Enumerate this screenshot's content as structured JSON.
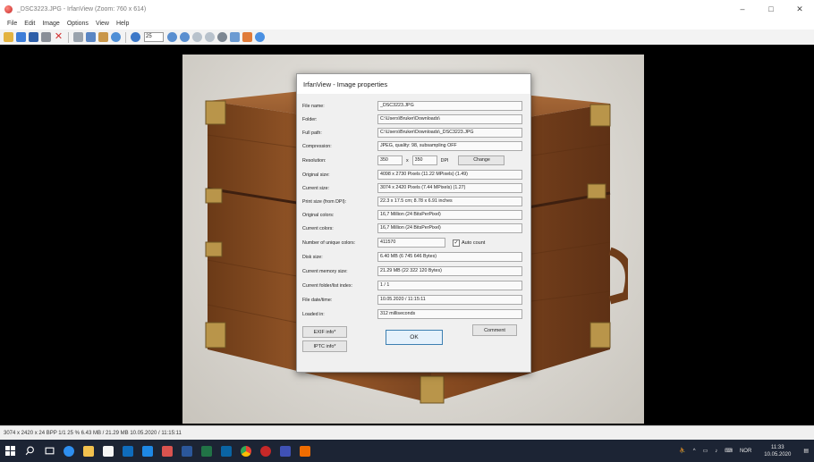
{
  "window": {
    "title": "_DSC3223.JPG - IrfanView (Zoom: 760 x 614)",
    "controls": {
      "minimize": "–",
      "maximize": "□",
      "close": "✕"
    }
  },
  "menu": [
    "File",
    "Edit",
    "Image",
    "Options",
    "View",
    "Help"
  ],
  "toolbar": {
    "zoom_value": "25",
    "icons": [
      "open-folder-icon",
      "slideshow-icon",
      "save-icon",
      "print-icon",
      "delete-icon",
      "cut-icon",
      "copy-icon",
      "paste-icon",
      "undo-icon",
      "info-icon",
      "zoom-select",
      "zoom-in-icon",
      "zoom-out-icon",
      "previous-icon",
      "next-icon",
      "settings-icon",
      "refresh-icon",
      "paint-icon",
      "about-icon"
    ]
  },
  "dialog": {
    "title": "IrfanView - Image properties",
    "rows": [
      {
        "label": "File name:",
        "value": "_DSC3223.JPG"
      },
      {
        "label": "Folder:",
        "value": "C:\\Users\\Bruker\\Downloads\\"
      },
      {
        "label": "Full path:",
        "value": "C:\\Users\\Bruker\\Downloads\\_DSC3223.JPG"
      },
      {
        "label": "Compression:",
        "value": "JPEG, quality: 98, subsampling OFF"
      },
      {
        "label": "Resolution:",
        "value": ""
      },
      {
        "label": "Original size:",
        "value": "4098 x 2730  Pixels (11.22 MPixels) (1.49)"
      },
      {
        "label": "Current size:",
        "value": "3074 x 2420  Pixels (7.44 MPixels) (1.27)"
      },
      {
        "label": "Print size (from DPI):",
        "value": "22.3 x 17.5 cm; 8.78 x 6.91 inches"
      },
      {
        "label": "Original colors:",
        "value": "16,7 Million   (24 BitsPerPixel)"
      },
      {
        "label": "Current colors:",
        "value": "16,7 Million   (24 BitsPerPixel)"
      },
      {
        "label": "Number of unique colors:",
        "value": "411570"
      },
      {
        "label": "Disk size:",
        "value": "6.40 MB (6 745 646 Bytes)"
      },
      {
        "label": "Current memory size:",
        "value": "21.29  MB (22 322 120 Bytes)"
      },
      {
        "label": "Current folder/list index:",
        "value": "1 / 1"
      },
      {
        "label": "File date/time:",
        "value": "10.05.2020 / 11:15:11"
      },
      {
        "label": "Loaded in:",
        "value": "312 milliseconds"
      }
    ],
    "resolution": {
      "x": "350",
      "sep": "x",
      "y": "350",
      "unit": "DPI",
      "change_label": "Change"
    },
    "auto_count_label": "Auto count",
    "auto_count_checked": "✓",
    "buttons": {
      "exif": "EXIF info*",
      "iptc": "IPTC info*",
      "ok": "OK",
      "comment": "Comment"
    }
  },
  "status": "3074 x 2420 x 24 BPP   1/1   25 %   6.43 MB / 21.29 MB   10.05.2020 / 11:15:11",
  "taskbar": {
    "apps": [
      "start-icon",
      "search-icon",
      "task-view-icon",
      "edge-icon",
      "file-explorer-icon",
      "store-icon",
      "mail-icon",
      "photos-icon",
      "word-icon",
      "excel-icon",
      "outlook-icon",
      "chrome-icon",
      "irfanview-icon",
      "word-alt-icon",
      "app-icon"
    ],
    "tray": {
      "chevron": "^",
      "lang": "NOR",
      "time": "11:33",
      "date": "10.05.2020"
    }
  }
}
